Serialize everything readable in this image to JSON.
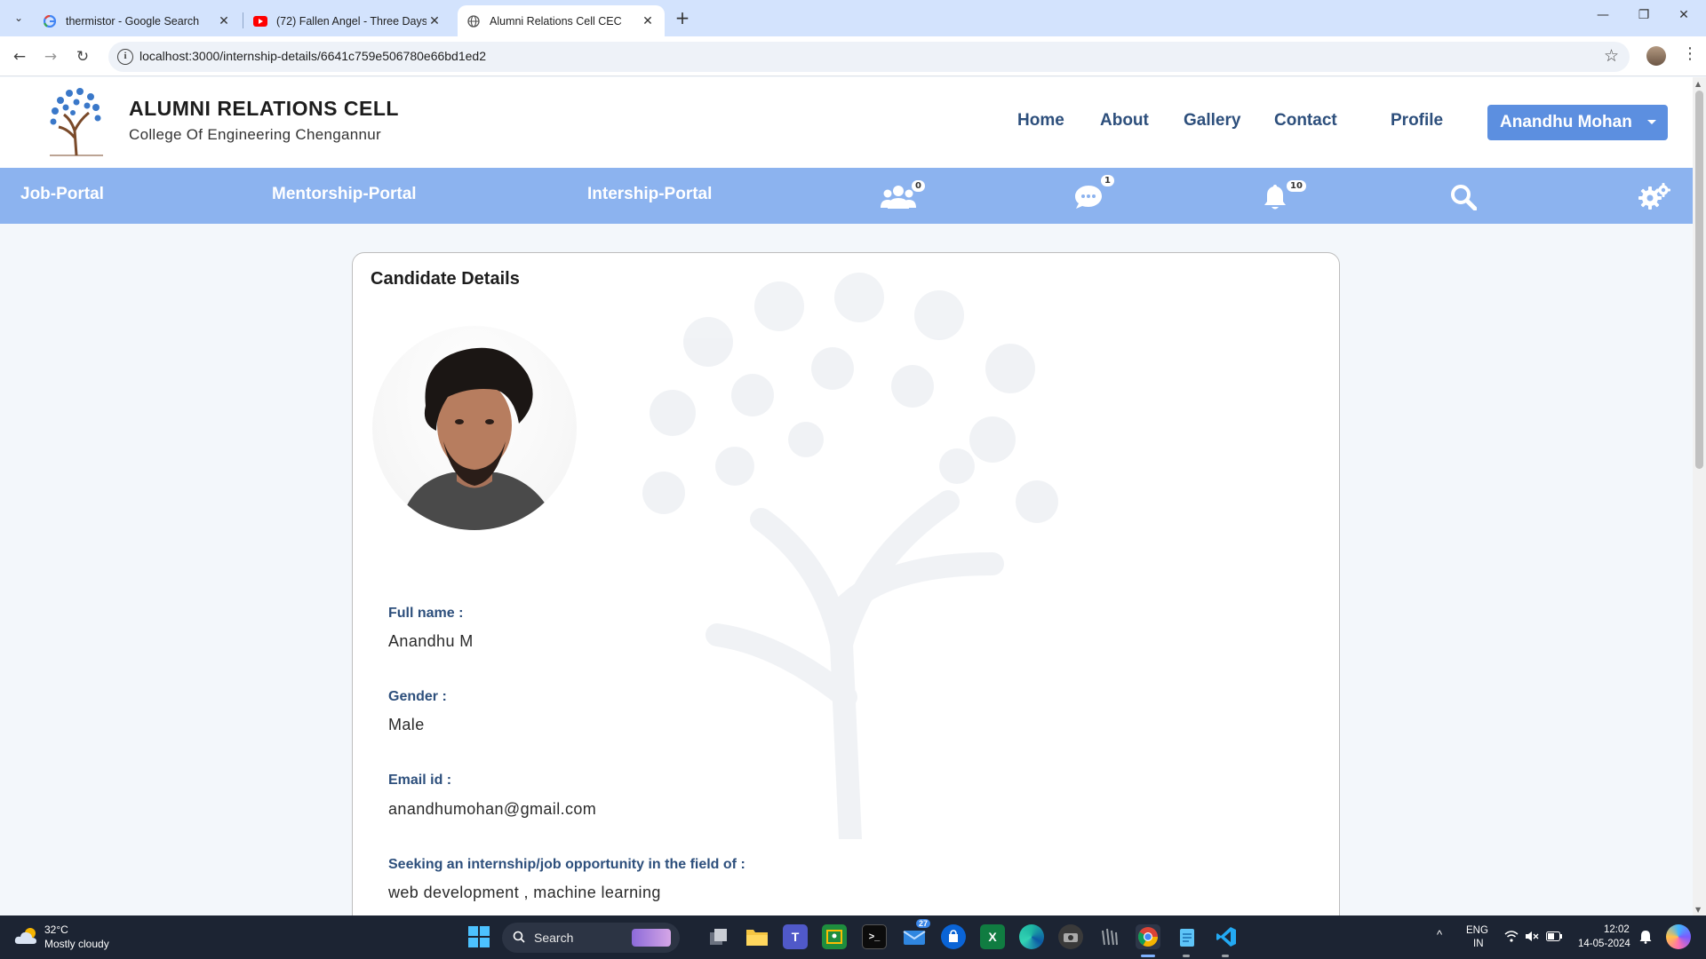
{
  "browser": {
    "tabs": [
      {
        "title": "thermistor - Google Search",
        "favicon": "google-icon",
        "active": false
      },
      {
        "title": "(72) Fallen Angel - Three Days G",
        "favicon": "youtube-icon",
        "active": false
      },
      {
        "title": "Alumni Relations Cell CEC",
        "favicon": "globe-icon",
        "active": true
      }
    ],
    "url": "localhost:3000/internship-details/6641c759e506780e66bd1ed2"
  },
  "header": {
    "title": "ALUMNI RELATIONS CELL",
    "subtitle": "College Of Engineering Chengannur",
    "nav": [
      "Home",
      "About",
      "Gallery",
      "Contact",
      "Profile"
    ],
    "user_name": "Anandhu Mohan"
  },
  "subnav": {
    "portals": [
      "Job-Portal",
      "Mentorship-Portal",
      "Intership-Portal"
    ],
    "connections_count": "0",
    "messages_count": "1",
    "notifications_count": "10"
  },
  "card": {
    "title": "Candidate Details",
    "fields": [
      {
        "label": "Full name :",
        "value": "Anandhu M"
      },
      {
        "label": "Gender :",
        "value": "Male"
      },
      {
        "label": "Email id :",
        "value": "anandhumohan@gmail.com"
      },
      {
        "label": "Seeking an internship/job opportunity in the field of :",
        "value": "web development , machine learning"
      }
    ]
  },
  "taskbar": {
    "temperature": "32°C",
    "weather": "Mostly cloudy",
    "search_label": "Search",
    "mail_badge": "27",
    "lang_line1": "ENG",
    "lang_line2": "IN",
    "time": "12:02",
    "date": "14-05-2024"
  }
}
